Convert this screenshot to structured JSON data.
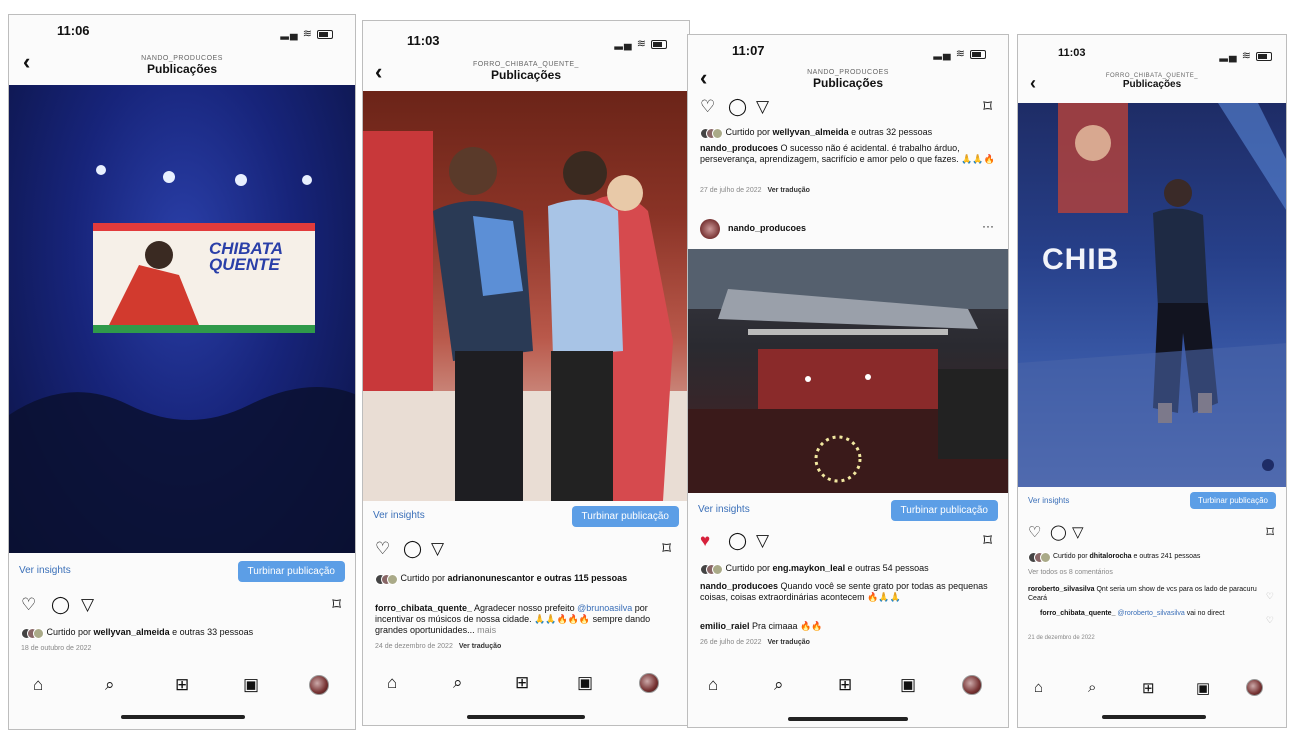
{
  "phones": [
    {
      "time": "11:06",
      "account": "NANDO_PRODUCOES",
      "title": "Publicações",
      "insights": "Ver insights",
      "boost": "Turbinar publicação",
      "likes_prefix": "Curtido por ",
      "likes_user": "wellyvan_almeida",
      "likes_suffix": " e outras 33 pessoas",
      "date": "18 de outubro de 2022",
      "screen_text_line1": "CHIBATA",
      "screen_text_line2": "QUENTE"
    },
    {
      "time": "11:03",
      "account": "FORRO_CHIBATA_QUENTE_",
      "title": "Publicações",
      "insights": "Ver insights",
      "boost": "Turbinar publicação",
      "likes_prefix": "Curtido por ",
      "likes_user": "adrianonunescantor",
      "likes_suffix": " e outras 115 pessoas",
      "caption_user": "forro_chibata_quente_",
      "caption_text_1": " Agradecer nosso prefeito ",
      "caption_mention": "@brunoasilva",
      "caption_text_2": " por incentivar os músicos de nossa cidade. 🙏🙏🔥🔥🔥 sempre dando grandes oportunidades...",
      "caption_more": " mais",
      "date": "24 de dezembro de 2022",
      "translate": "Ver tradução"
    },
    {
      "time": "11:07",
      "account": "NANDO_PRODUCOES",
      "title": "Publicações",
      "top_likes_prefix": "Curtido por ",
      "top_likes_user": "wellyvan_almeida",
      "top_likes_suffix": " e outras 32 pessoas",
      "top_caption_user": "nando_producoes",
      "top_caption_text": " O sucesso não é acidental. é trabalho árduo, perseverança, aprendizagem, sacrifício e amor pelo o que fazes. 🙏🙏🔥",
      "top_date": "27 de julho de 2022",
      "translate": "Ver tradução",
      "post_user": "nando_producoes",
      "insights": "Ver insights",
      "boost": "Turbinar publicação",
      "likes_prefix": "Curtido por ",
      "likes_user": "eng.maykon_leal",
      "likes_suffix": " e outras 54 pessoas",
      "caption_user": "nando_producoes",
      "caption_text": " Quando você se sente grato por todas as pequenas coisas, coisas extraordinárias acontecem 🔥🙏🙏",
      "comment_user": "emilio_raiel",
      "comment_text": " Pra cimaaa 🔥🔥",
      "date": "26 de julho de 2022",
      "translate2": "Ver tradução"
    },
    {
      "time": "11:03",
      "account": "FORRO_CHIBATA_QUENTE_",
      "title": "Publicações",
      "screen_text": "CHIB",
      "insights": "Ver insights",
      "boost": "Turbinar publicação",
      "likes_prefix": "Curtido por ",
      "likes_user": "dhitalorocha",
      "likes_suffix": " e outras 241 pessoas",
      "view_comments": "Ver todos os 8 comentários",
      "comment1_user": "roroberto_silvasilva",
      "comment1_text": " Qnt seria um show  de vcs para os lado de paracuru Ceará",
      "comment2_user": "forro_chibata_quente_",
      "comment2_mention": " @roroberto_silvasilva",
      "comment2_text": " vai no direct",
      "date": "21 de dezembro de 2022"
    }
  ],
  "icons": {
    "back": "‹",
    "heart": "♡",
    "heart_filled": "♥",
    "comment": "◯",
    "share": "▽",
    "bookmark": "⌑",
    "more": "···",
    "home": "⌂",
    "search": "⌕",
    "add": "⊞",
    "reels": "▣"
  },
  "colors": {
    "accent_blue": "#5c9ee6",
    "link_blue": "#3a6fb8",
    "like_red": "#d6203a"
  }
}
